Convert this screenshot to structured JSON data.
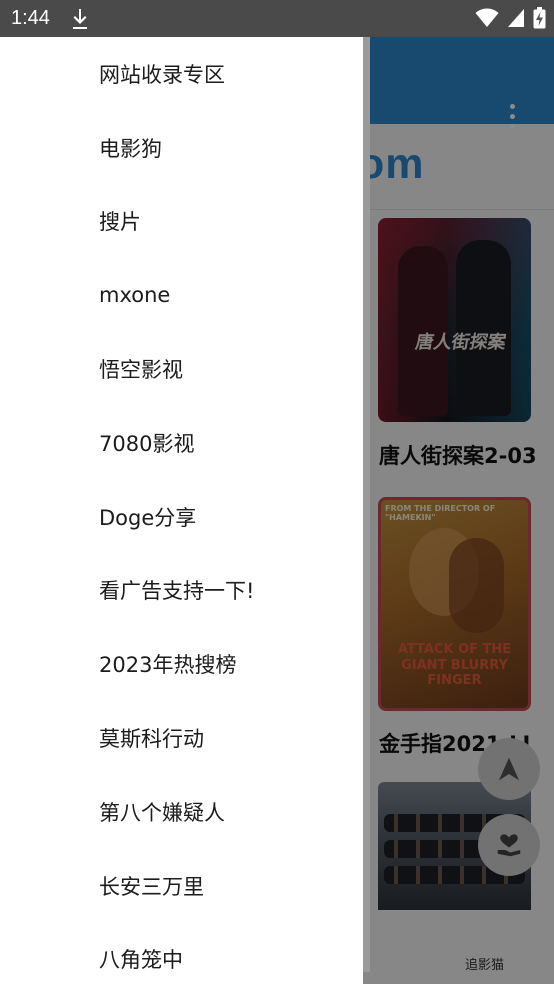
{
  "status_bar": {
    "time": "1:44",
    "icons": [
      "download-icon",
      "wifi-icon",
      "signal-icon",
      "battery-charging-icon"
    ]
  },
  "drawer": {
    "items": [
      {
        "label": "网站收录专区"
      },
      {
        "label": "电影狗"
      },
      {
        "label": "搜片"
      },
      {
        "label": "mxone"
      },
      {
        "label": "悟空影视"
      },
      {
        "label": "7080影视"
      },
      {
        "label": "Doge分享"
      },
      {
        "label": "看广告支持一下!"
      },
      {
        "label": "2023年热搜榜"
      },
      {
        "label": "莫斯科行动"
      },
      {
        "label": "第八个嫌疑人"
      },
      {
        "label": "长安三万里"
      },
      {
        "label": "八角笼中"
      }
    ]
  },
  "background": {
    "toolbar_color": "#2a87c8",
    "logo_text": "om",
    "cards": [
      {
        "title": "唐人街探案2-03",
        "poster_text": "唐人街探案"
      },
      {
        "title": "金手指2021-LI",
        "poster_top_text": "FROM THE DIRECTOR OF \"HAMEKIN\"",
        "poster_title_1": "ATTACK OF THE",
        "poster_title_2": "GIANT BLURRY FINGER"
      },
      {
        "title": ""
      }
    ],
    "bottom_tab_label": "追影猫"
  }
}
